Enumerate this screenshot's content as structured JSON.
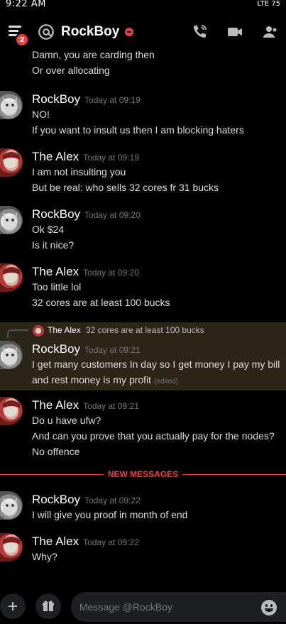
{
  "status_bar": {
    "time": "9:22 AM",
    "right_info": "LTE 75"
  },
  "header": {
    "title": "RockBoy",
    "menu_badge": "2"
  },
  "reply": {
    "name": "The Alex",
    "text": "32 cores are at least 100 bucks"
  },
  "messages": [
    {
      "author": "",
      "time": "",
      "lines": [
        "Damn, you are carding then",
        "Or over allocating"
      ]
    },
    {
      "author": "RockBoy",
      "time": "Today at 09:19",
      "lines": [
        "NO!",
        "If you want to insult us then I am blocking haters"
      ]
    },
    {
      "author": "The Alex",
      "time": "Today at 09:19",
      "lines": [
        "I am not insulting you",
        "But be real: who sells 32 cores fr 31 bucks"
      ]
    },
    {
      "author": "RockBoy",
      "time": "Today at 09:20",
      "lines": [
        "Ok $24",
        "Is it nice?"
      ]
    },
    {
      "author": "The Alex",
      "time": "Today at 09:20",
      "lines": [
        "Too little lol",
        "32 cores are at least 100 bucks"
      ]
    },
    {
      "author": "RockBoy",
      "time": "Today at 09:21",
      "lines": [
        "I get many customers In day so I get money I pay my bill",
        "and rest money is my profit"
      ],
      "edited": "(edited)"
    },
    {
      "author": "The Alex",
      "time": "Today at 09:21",
      "lines": [
        "Do u have ufw?",
        "And can you prove that you actually pay for the nodes?",
        "No offence"
      ]
    },
    {
      "author": "RockBoy",
      "time": "Today at 09:22",
      "lines": [
        "I will give you proof in month of end"
      ]
    },
    {
      "author": "The Alex",
      "time": "Today at 09:22",
      "lines": [
        "Why?"
      ]
    }
  ],
  "divider_label": "NEW MESSAGES",
  "composer": {
    "placeholder": "Message @RockBoy"
  },
  "colors": {
    "background": "#000000",
    "text": "#dcddde",
    "muted": "#72767d",
    "danger": "#ed4245",
    "highlight": "#2b2618"
  }
}
